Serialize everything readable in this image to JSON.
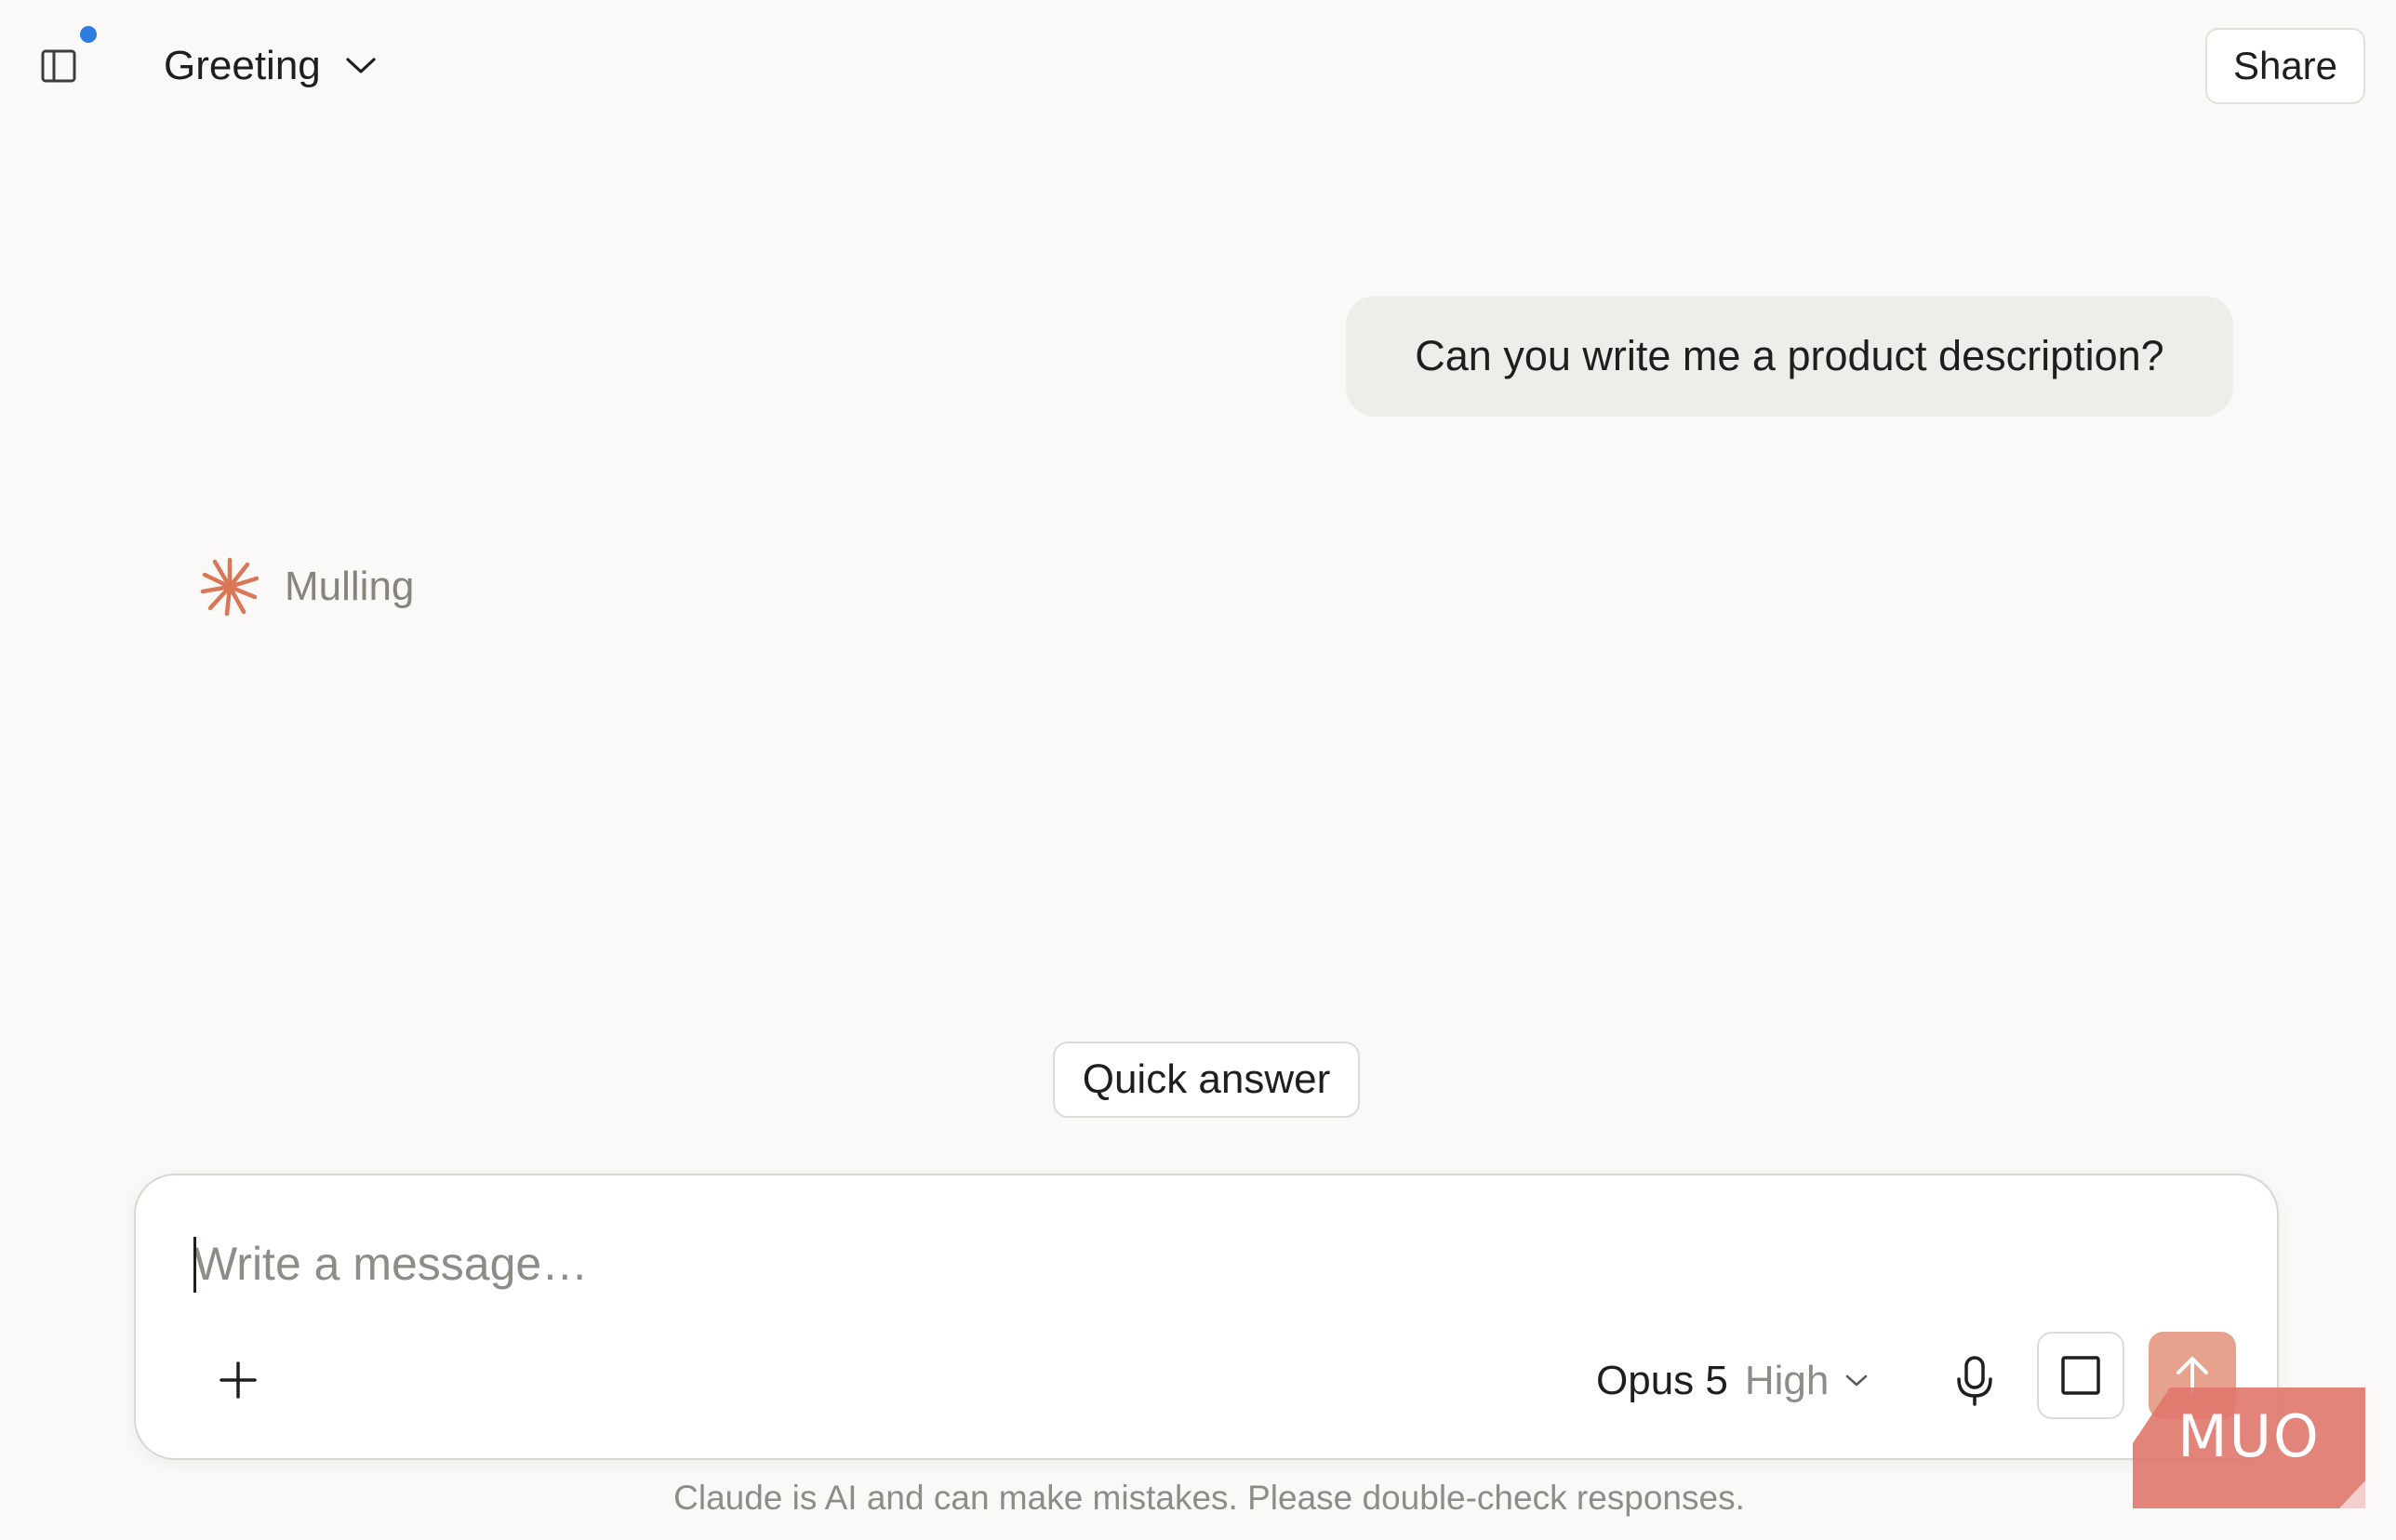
{
  "header": {
    "title": "Greeting",
    "share_label": "Share",
    "notification_color": "#2D7DE0"
  },
  "conversation": {
    "user_message": "Can you write me a product description?",
    "assistant_status": "Mulling",
    "assistant_icon": "claude-spark-icon",
    "accent_color": "#D97757"
  },
  "quick_answer_label": "Quick answer",
  "composer": {
    "placeholder": "Write a message…",
    "model_name": "Opus 5",
    "effort_level": "High",
    "send_color": "#E7A28E"
  },
  "disclaimer": "Claude is AI and can make mistakes. Please double-check responses.",
  "watermark": {
    "text": "MUO",
    "color": "#E0776D"
  }
}
